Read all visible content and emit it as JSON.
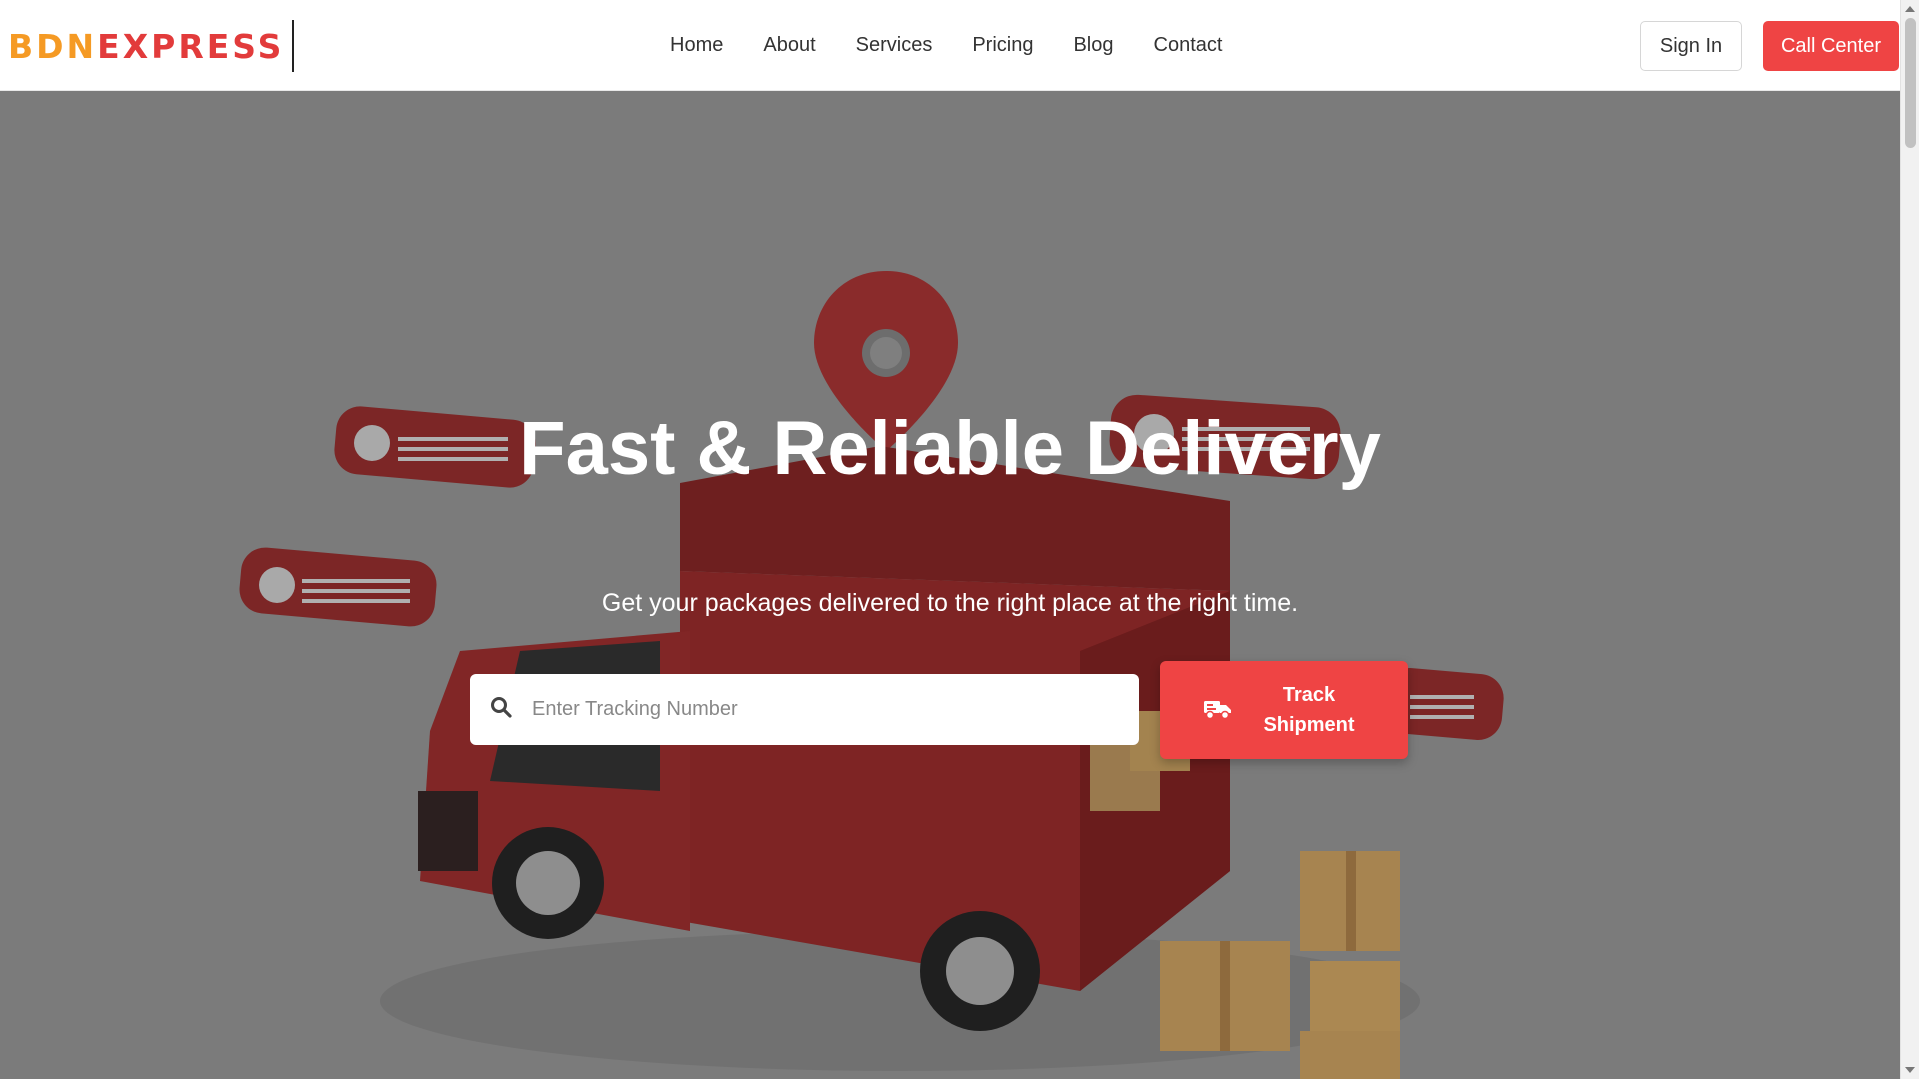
{
  "brand": {
    "part1": "BDN",
    "part2": "EXPRESS"
  },
  "nav": {
    "links": [
      "Home",
      "About",
      "Services",
      "Pricing",
      "Blog",
      "Contact"
    ]
  },
  "header": {
    "sign_in": "Sign In",
    "call_center": "Call Center"
  },
  "hero": {
    "title": "Fast & Reliable Delivery",
    "subtitle": "Get your packages delivered to the right place at the right time.",
    "search_placeholder": "Enter Tracking Number",
    "search_value": "",
    "track_button": "Track Shipment"
  },
  "colors": {
    "accent": "#ef4444",
    "logo_orange": "#f59a24",
    "hero_overlay": "#7b7b7b"
  },
  "icons": [
    "search-icon",
    "truck-icon"
  ]
}
